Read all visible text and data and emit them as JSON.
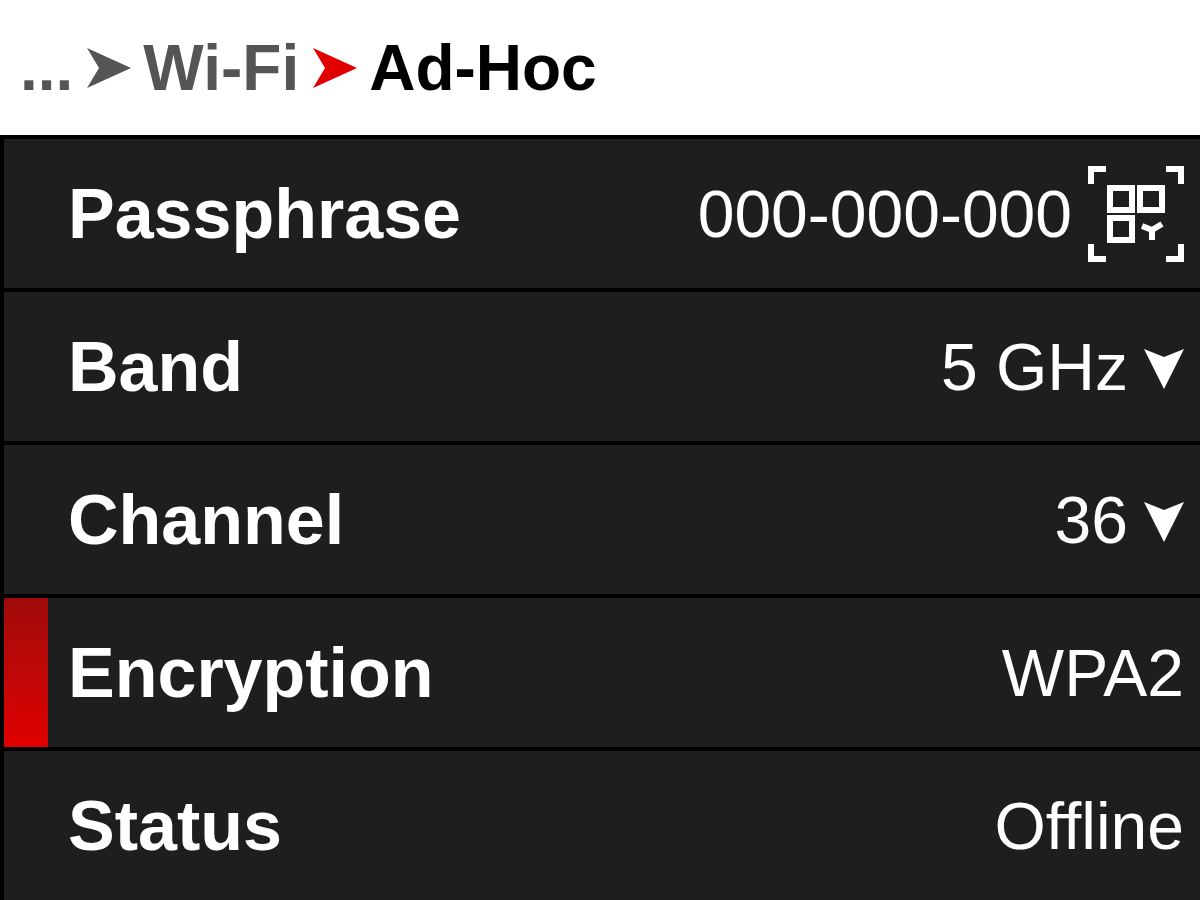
{
  "breadcrumb": [
    {
      "label": "...",
      "current": false
    },
    {
      "label": "Wi-Fi",
      "current": false
    },
    {
      "label": "Ad-Hoc",
      "current": true
    }
  ],
  "settings": [
    {
      "kind": "qr",
      "label": "Passphrase",
      "value": "000-000-000",
      "selected": false
    },
    {
      "kind": "dropdown",
      "label": "Band",
      "value": "5 GHz",
      "selected": false
    },
    {
      "kind": "dropdown",
      "label": "Channel",
      "value": "36",
      "selected": false
    },
    {
      "kind": "plain",
      "label": "Encryption",
      "value": "WPA2",
      "selected": true
    },
    {
      "kind": "plain",
      "label": "Status",
      "value": "Offline",
      "selected": false
    }
  ]
}
